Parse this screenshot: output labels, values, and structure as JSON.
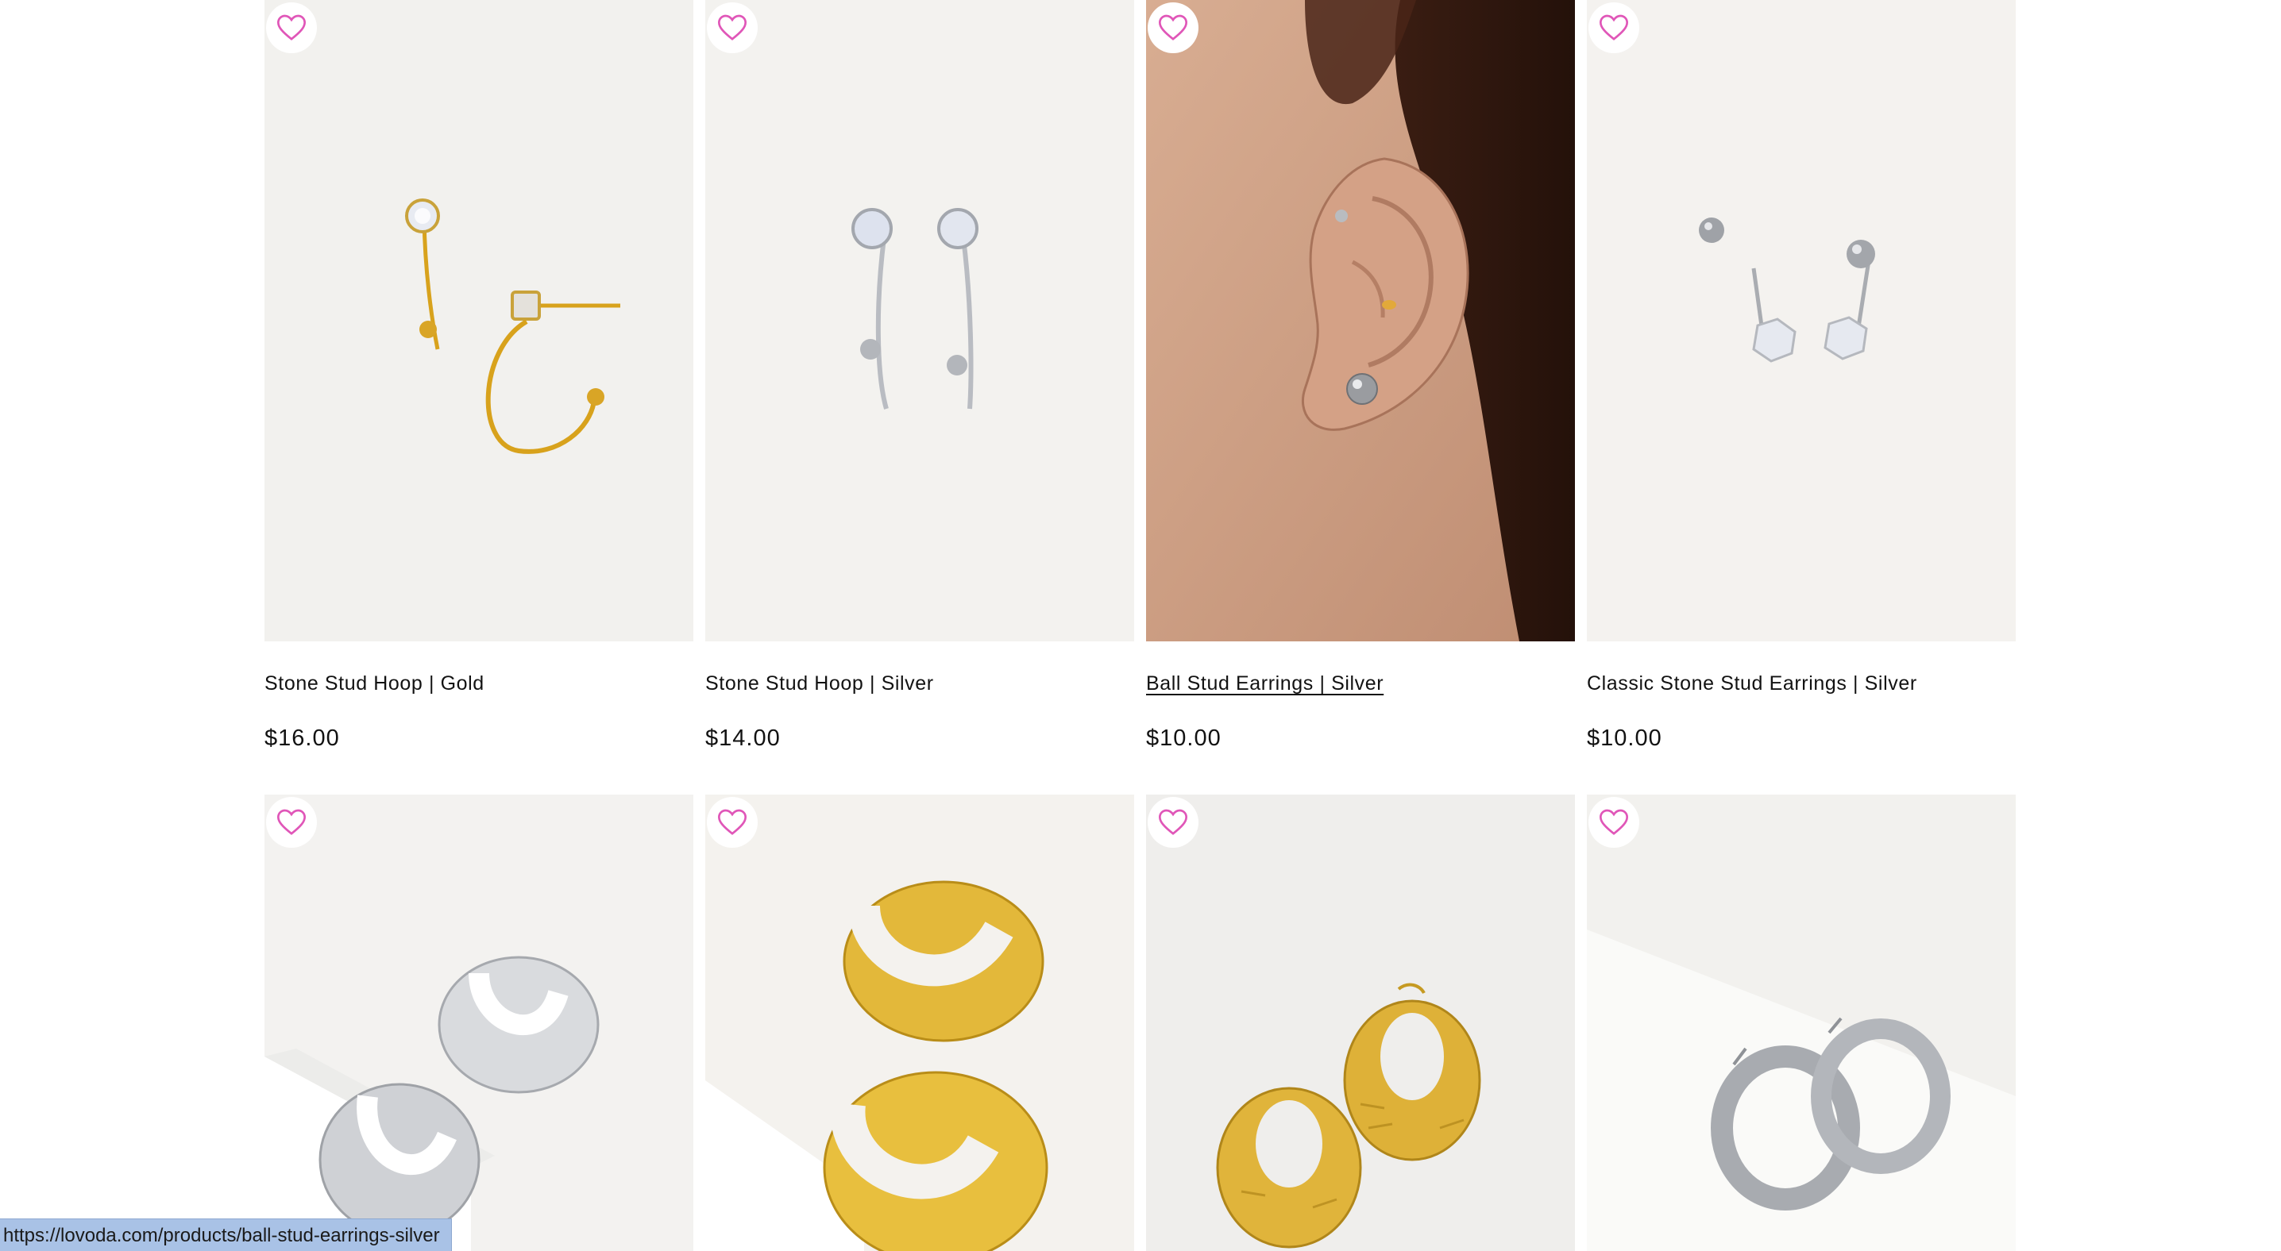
{
  "products_row1": [
    {
      "title": "Stone Stud Hoop | Gold",
      "price": "$16.00",
      "image_icon": "gold-stone-stud-hoop-image"
    },
    {
      "title": "Stone Stud Hoop | Silver",
      "price": "$14.00",
      "image_icon": "silver-stone-stud-hoop-image"
    },
    {
      "title": "Ball Stud Earrings | Silver",
      "price": "$10.00",
      "image_icon": "ear-with-ball-stud-image"
    },
    {
      "title": "Classic Stone Stud Earrings | Silver",
      "price": "$10.00",
      "image_icon": "classic-stone-stud-image"
    }
  ],
  "products_row2": [
    {
      "image_icon": "silver-chunky-hoop-image"
    },
    {
      "image_icon": "gold-chunky-hoop-image"
    },
    {
      "image_icon": "gold-textured-hoop-image"
    },
    {
      "image_icon": "silver-tube-hoop-image"
    }
  ],
  "wishlist_icon": "heart-outline-icon",
  "colors": {
    "heart": "#e056b8",
    "text": "#121212",
    "status_bar": "#a9c2e6"
  },
  "status_bar": {
    "url": "https://lovoda.com/products/ball-stud-earrings-silver"
  }
}
